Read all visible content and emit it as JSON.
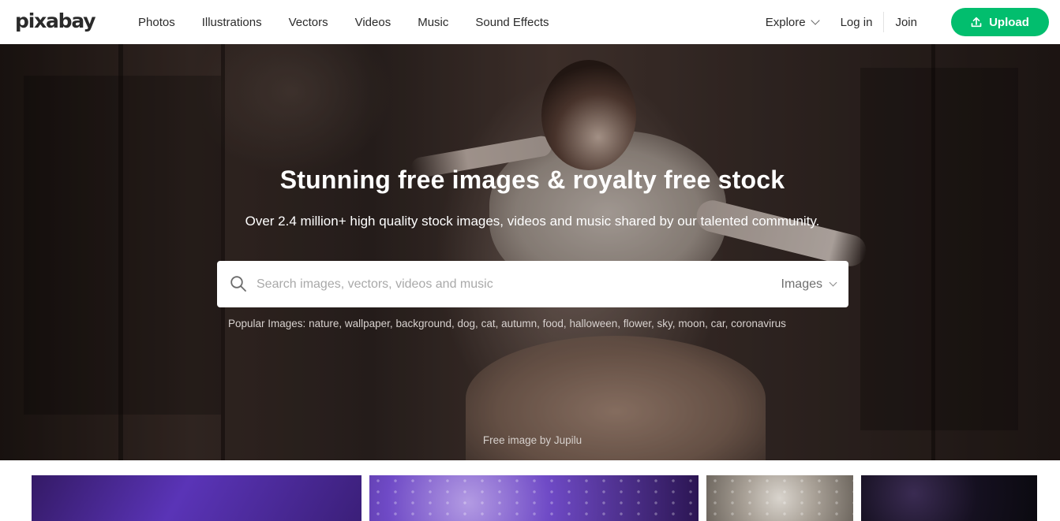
{
  "brand": {
    "logo": "pixabay",
    "accent_color": "#02be6e"
  },
  "nav": {
    "items": [
      {
        "label": "Photos"
      },
      {
        "label": "Illustrations"
      },
      {
        "label": "Vectors"
      },
      {
        "label": "Videos"
      },
      {
        "label": "Music"
      },
      {
        "label": "Sound Effects"
      }
    ],
    "explore": "Explore",
    "login": "Log in",
    "join": "Join",
    "upload": "Upload"
  },
  "hero": {
    "title": "Stunning free images & royalty free stock",
    "subtitle": "Over 2.4 million+ high quality stock images, videos and music shared by our talented community.",
    "credit": "Free image by Jupilu"
  },
  "search": {
    "placeholder": "Search images, vectors, videos and music",
    "value": "",
    "type_selected": "Images"
  },
  "popular": {
    "label": "Popular Images:",
    "tags": [
      "nature",
      "wallpaper",
      "background",
      "dog",
      "cat",
      "autumn",
      "food",
      "halloween",
      "flower",
      "sky",
      "moon",
      "car",
      "coronavirus"
    ]
  },
  "icons": {
    "search": "search-icon",
    "upload": "upload-icon",
    "explore_chevron": "chevron-down-icon",
    "type_chevron": "chevron-down-icon"
  }
}
